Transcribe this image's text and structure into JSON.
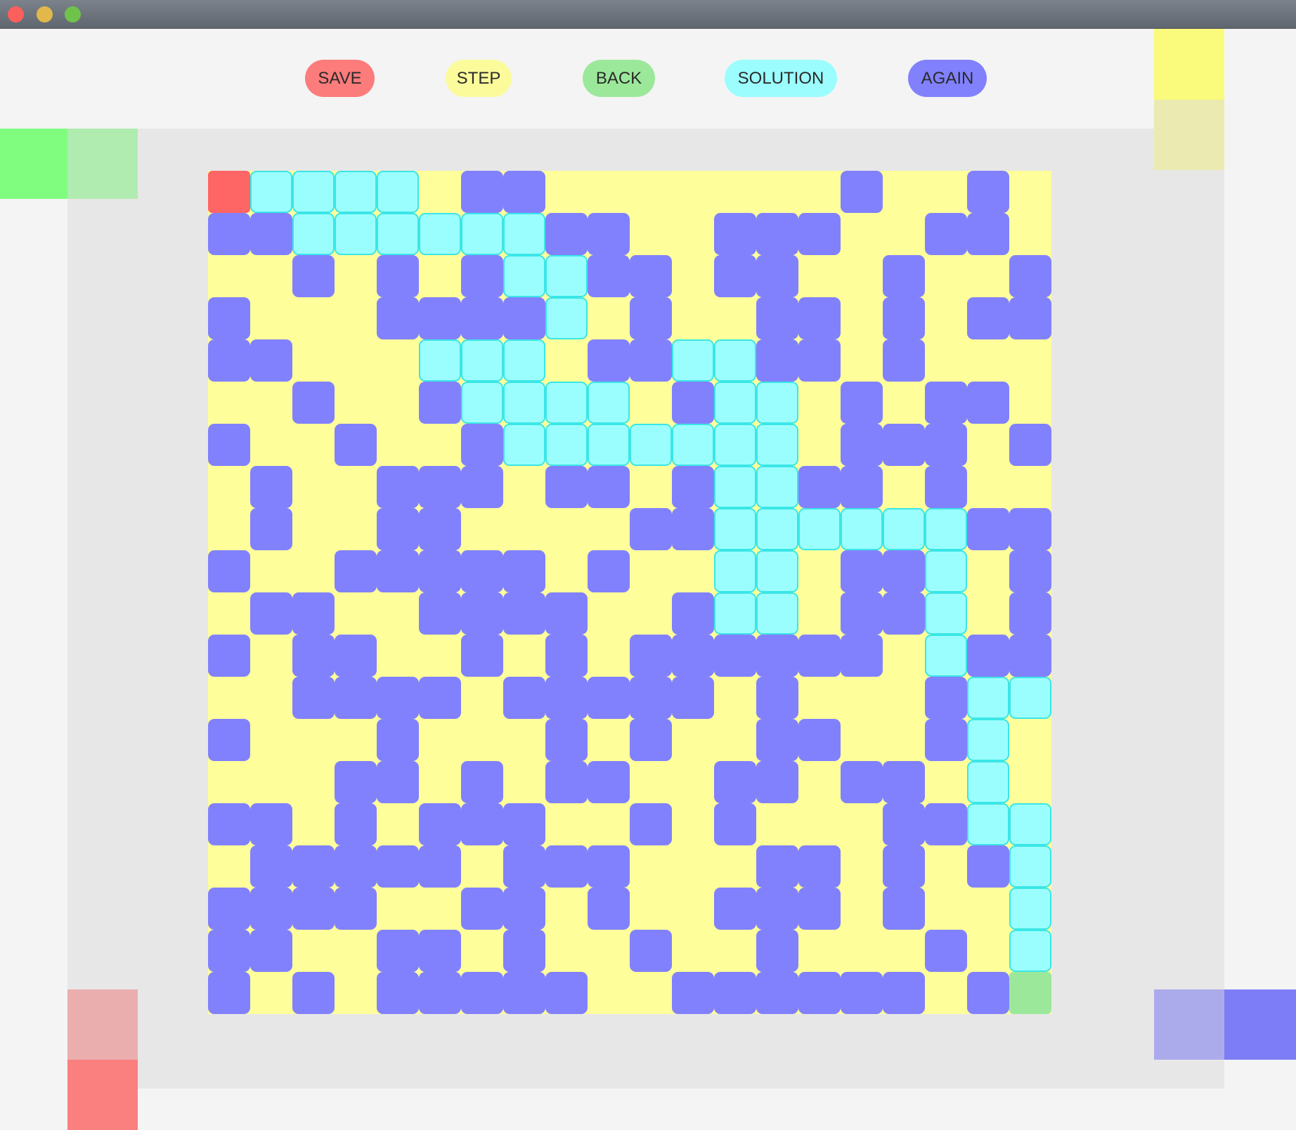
{
  "buttons": [
    {
      "label": "SAVE",
      "color": "#fc7b7b"
    },
    {
      "label": "STEP",
      "color": "#fbfb9b"
    },
    {
      "label": "BACK",
      "color": "#9be89b"
    },
    {
      "label": "SOLUTION",
      "color": "#9bfdfd"
    },
    {
      "label": "AGAIN",
      "color": "#8181fd"
    }
  ],
  "colors": {
    "open": "#fefe9b",
    "wall": "#8181fd",
    "solution": "#9bfefe",
    "start": "#fe6565",
    "goal": "#9be89b"
  },
  "maze": {
    "legend": {
      ".": "open",
      "#": "wall",
      "o": "solution",
      "S": "start",
      "G": "goal"
    },
    "rows": [
      "Soooo.##.......#..#..",
      "##oooooo##..###..##.",
      "..#.#.#oo##.##..#..#",
      "#...####o.#..##.#.##",
      "##...ooo.##oo##.#...",
      "..#..#oooo.#oo.#.##.",
      "#..#..#ooooooo.###.#",
      ".#..###.##.#oo##.#..",
      ".#..##....##oooooo##",
      "#..#####.#..oo.##o.#",
      ".##..####..#oo.##o.#",
      "#.##..#.#.######.o##",
      "..####.#####.#...#oo#",
      "#...#...#.#..##..#o.",
      "...##.#.##..##.##.o.",
      "##.#.###..#.#...##oo",
      ".#####.###...##.#.#o",
      "####..##.#..###.#..o",
      "##..##.#..#..#...#.o",
      "#.#.#####..######.#G"
    ]
  }
}
